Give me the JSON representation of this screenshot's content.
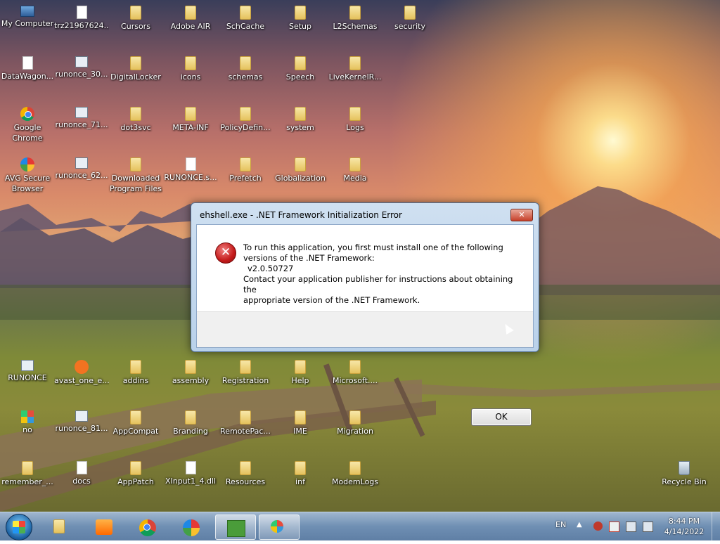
{
  "desktop_icons": [
    {
      "label": "My Computer",
      "icon": "computer-icon"
    },
    {
      "label": "trz21967624...",
      "icon": "file-icon"
    },
    {
      "label": "Cursors",
      "icon": "folder-icon"
    },
    {
      "label": "Adobe AIR",
      "icon": "folder-icon"
    },
    {
      "label": "SchCache",
      "icon": "folder-icon"
    },
    {
      "label": "Setup",
      "icon": "folder-icon"
    },
    {
      "label": "L2Schemas",
      "icon": "folder-icon"
    },
    {
      "label": "security",
      "icon": "folder-icon"
    },
    {
      "label": "DataWagon...",
      "icon": "file-icon"
    },
    {
      "label": "runonce_30...",
      "icon": "exe-icon"
    },
    {
      "label": "DigitalLocker",
      "icon": "folder-icon"
    },
    {
      "label": "icons",
      "icon": "folder-icon"
    },
    {
      "label": "schemas",
      "icon": "folder-icon"
    },
    {
      "label": "Speech",
      "icon": "folder-icon"
    },
    {
      "label": "LiveKernelR...",
      "icon": "folder-icon"
    },
    {
      "label": "Google Chrome",
      "icon": "chrome-icon"
    },
    {
      "label": "runonce_71...",
      "icon": "exe-icon"
    },
    {
      "label": "dot3svc",
      "icon": "folder-icon"
    },
    {
      "label": "META-INF",
      "icon": "folder-icon"
    },
    {
      "label": "PolicyDefin...",
      "icon": "folder-icon"
    },
    {
      "label": "system",
      "icon": "folder-icon"
    },
    {
      "label": "Logs",
      "icon": "folder-icon"
    },
    {
      "label": "AVG Secure Browser",
      "icon": "avg-browser-icon"
    },
    {
      "label": "runonce_62...",
      "icon": "exe-icon"
    },
    {
      "label": "Downloaded Program Files",
      "icon": "folder-icon"
    },
    {
      "label": "RUNONCE.s...",
      "icon": "file-icon"
    },
    {
      "label": "Prefetch",
      "icon": "folder-icon"
    },
    {
      "label": "Globalization",
      "icon": "folder-icon"
    },
    {
      "label": "Media",
      "icon": "folder-icon"
    },
    {
      "label": "RUNONCE",
      "icon": "exe-icon"
    },
    {
      "label": "avast_one_e...",
      "icon": "avast-icon"
    },
    {
      "label": "addins",
      "icon": "folder-icon"
    },
    {
      "label": "assembly",
      "icon": "folder-icon"
    },
    {
      "label": "Registration",
      "icon": "folder-icon"
    },
    {
      "label": "Help",
      "icon": "folder-icon"
    },
    {
      "label": "Microsoft....",
      "icon": "folder-icon"
    },
    {
      "label": "no",
      "icon": "app-icon"
    },
    {
      "label": "runonce_81...",
      "icon": "exe-icon"
    },
    {
      "label": "AppCompat",
      "icon": "folder-icon"
    },
    {
      "label": "Branding",
      "icon": "folder-icon"
    },
    {
      "label": "RemotePac...",
      "icon": "folder-icon"
    },
    {
      "label": "IME",
      "icon": "folder-icon"
    },
    {
      "label": "Migration",
      "icon": "folder-icon"
    },
    {
      "label": "remember_...",
      "icon": "folder-icon"
    },
    {
      "label": "docs",
      "icon": "file-icon"
    },
    {
      "label": "AppPatch",
      "icon": "folder-icon"
    },
    {
      "label": "XInput1_4.dll",
      "icon": "file-icon"
    },
    {
      "label": "Resources",
      "icon": "folder-icon"
    },
    {
      "label": "inf",
      "icon": "folder-icon"
    },
    {
      "label": "ModemLogs",
      "icon": "folder-icon"
    },
    {
      "label": "Recycle Bin",
      "icon": "recycle-bin-icon"
    }
  ],
  "dialog": {
    "title": "ehshell.exe - .NET Framework Initialization Error",
    "close_label": "✕",
    "message_line1": "To run this application, you first must install one of the following",
    "message_line2": "versions of the .NET Framework:",
    "message_version": "v2.0.50727",
    "message_line3": "Contact your application publisher for instructions about obtaining the",
    "message_line4": "appropriate version of the .NET Framework.",
    "ok_label": "OK",
    "icon": "error-icon"
  },
  "taskbar": {
    "pinned": [
      {
        "name": "windows-explorer",
        "icon": "folder-icon"
      },
      {
        "name": "media-player",
        "icon": "media-player-icon"
      },
      {
        "name": "google-chrome",
        "icon": "chrome-icon"
      },
      {
        "name": "avg-browser",
        "icon": "avg-browser-icon"
      },
      {
        "name": "notepad-app",
        "icon": "edit-icon"
      },
      {
        "name": "windows-app",
        "icon": "windows-icon"
      }
    ],
    "language": "EN",
    "time": "8:44 PM",
    "date": "4/14/2022"
  },
  "colors": {
    "dialog_frame": "#b9d1ea",
    "close_button": "#c7402a",
    "taskbar": "#6f8fb3"
  }
}
